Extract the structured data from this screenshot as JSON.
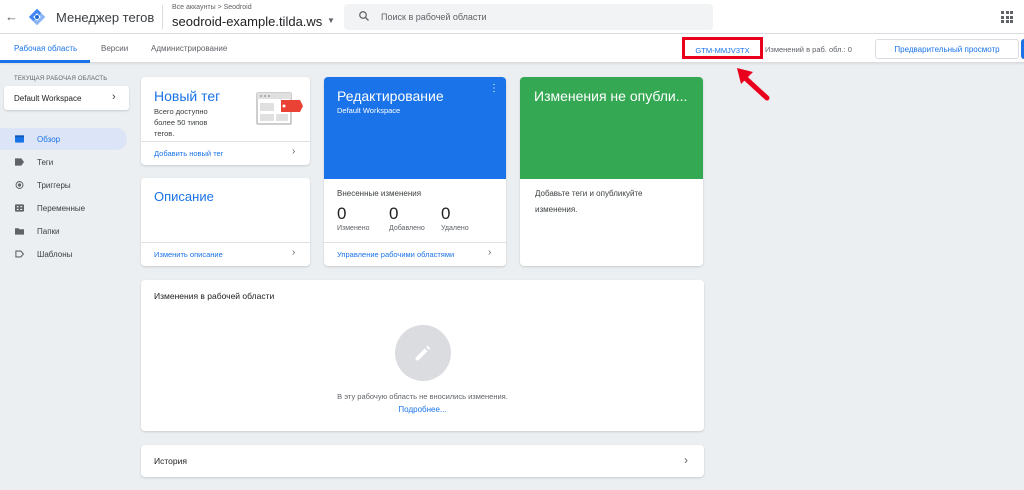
{
  "header": {
    "app_name": "Менеджер тегов",
    "breadcrumb": "Все аккаунты > Seodroid",
    "container_name": "seodroid-example.tilda.ws",
    "search_placeholder": "Поиск в рабочей области"
  },
  "nav": {
    "tabs": [
      {
        "label": "Рабочая область",
        "active": true
      },
      {
        "label": "Версии",
        "active": false
      },
      {
        "label": "Администрирование",
        "active": false
      }
    ],
    "container_id": "GTM-MMJV3TX",
    "workspace_changes": "Изменений в раб. обл.: 0",
    "preview_label": "Предварительный просмотр"
  },
  "sidebar": {
    "workspace_label": "ТЕКУЩАЯ РАБОЧАЯ ОБЛАСТЬ",
    "workspace_name": "Default Workspace",
    "items": [
      {
        "label": "Обзор",
        "icon": "overview-icon",
        "active": true
      },
      {
        "label": "Теги",
        "icon": "tag-icon",
        "active": false
      },
      {
        "label": "Триггеры",
        "icon": "trigger-icon",
        "active": false
      },
      {
        "label": "Переменные",
        "icon": "variables-icon",
        "active": false
      },
      {
        "label": "Папки",
        "icon": "folder-icon",
        "active": false
      },
      {
        "label": "Шаблоны",
        "icon": "templates-icon",
        "active": false
      }
    ]
  },
  "cards": {
    "new_tag": {
      "title": "Новый тег",
      "description_lines": [
        "Всего доступно",
        "более 50 типов",
        "тегов."
      ],
      "link": "Добавить новый тег"
    },
    "description": {
      "title": "Описание",
      "link": "Изменить описание"
    },
    "editing": {
      "title": "Редактирование",
      "subtitle": "Default Workspace",
      "changes_title": "Внесенные изменения",
      "stats": [
        {
          "value": "0",
          "label": "Изменено"
        },
        {
          "value": "0",
          "label": "Добавлено"
        },
        {
          "value": "0",
          "label": "Удалено"
        }
      ],
      "link": "Управление рабочими областями"
    },
    "unpublished": {
      "title": "Изменения не опубли...",
      "text_lines": [
        "Добавьте теги и опубликуйте",
        "изменения."
      ]
    },
    "workspace_changes": {
      "title": "Изменения в рабочей области",
      "empty_text": "В эту рабочую область не вносились изменения.",
      "more_link": "Подробнее..."
    },
    "history": {
      "title": "История"
    }
  },
  "colors": {
    "accent": "#1a73e8",
    "green": "#34a853",
    "highlight": "#e8001c",
    "tag_red": "#ea4335"
  }
}
